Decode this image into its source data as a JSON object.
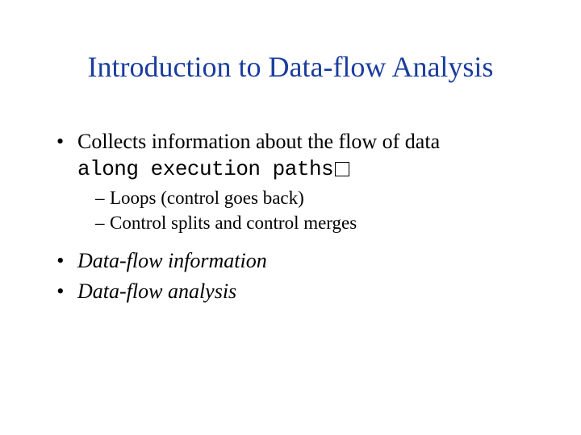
{
  "title": "Introduction to Data-flow Analysis",
  "bullets": {
    "b1": {
      "line1": "Collects information about the flow of data",
      "line2_mono": "along execution paths",
      "subs": {
        "s1": "Loops (control goes back)",
        "s2": "Control splits and control merges"
      }
    },
    "b2": "Data-flow information",
    "b3": "Data-flow analysis"
  }
}
